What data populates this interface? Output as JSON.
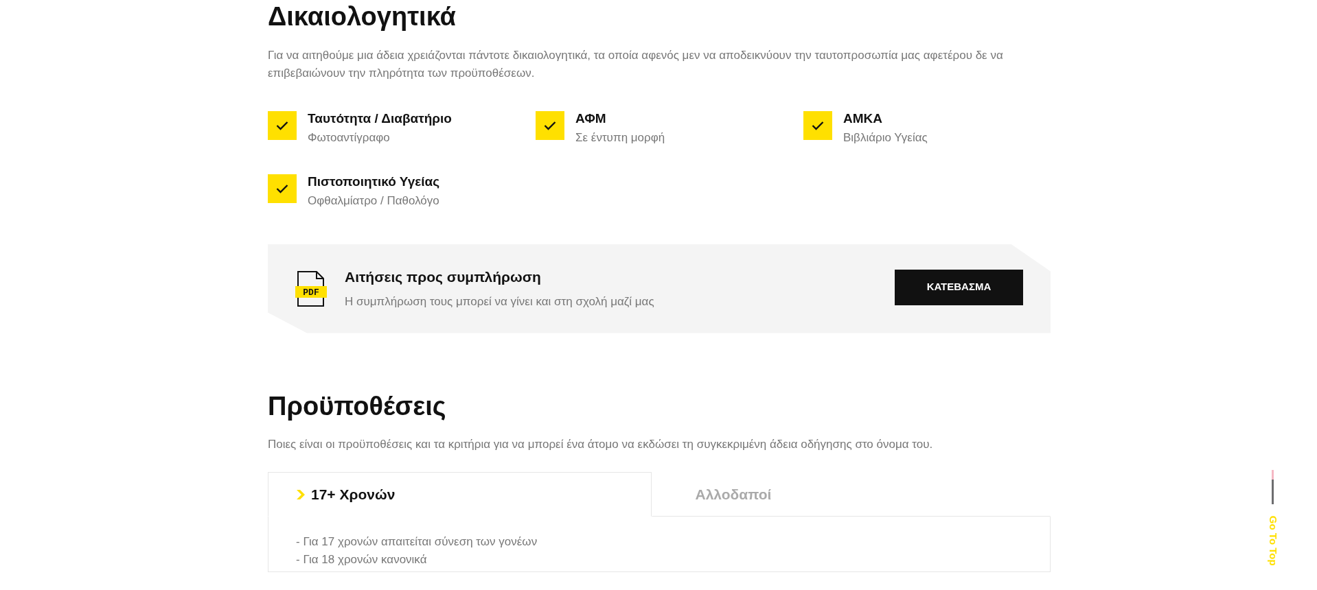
{
  "documents_section": {
    "title": "Δικαιολογητικά",
    "intro": "Για να αιτηθούμε μια άδεια χρειάζονται πάντοτε δικαιολογητικά, τα οποία αφενός μεν να αποδεικνύουν την ταυτοπροσωπία μας αφετέρου δε να επιβεβαιώνουν την πληρότητα των προϋποθέσεων.",
    "items": [
      {
        "title": "Ταυτότητα / Διαβατήριο",
        "subtitle": "Φωτοαντίγραφο"
      },
      {
        "title": "ΑΦΜ",
        "subtitle": "Σε έντυπη μορφή"
      },
      {
        "title": "ΑΜΚΑ",
        "subtitle": "Βιβλιάριο Υγείας"
      },
      {
        "title": "Πιστοποιητικό Υγείας",
        "subtitle": "Οφθαλμίατρο / Παθολόγο"
      }
    ],
    "download": {
      "file_badge": "PDF",
      "title": "Αιτήσεις προς συμπλήρωση",
      "subtitle": "Η συμπλήρωση τους μπορεί να γίνει και στη σχολή μαζί μας",
      "button": "ΚΑΤΕΒΑΣΜΑ"
    }
  },
  "requirements_section": {
    "title": "Προϋποθέσεις",
    "intro": "Ποιες είναι οι προϋποθέσεις και τα κριτήρια για να μπορεί ένα άτομο να εκδώσει τη συγκεκριμένη άδεια οδήγησης στο όνομα του.",
    "tabs": [
      {
        "label": "17+ Χρονών",
        "selected": true
      },
      {
        "label": "Αλλοδαποί",
        "selected": false
      }
    ],
    "panel_lines": [
      "- Για 17 χρονών απαιτείται σύνεση των γονέων",
      "- Για 18 χρονών κανονικά"
    ]
  },
  "go_to_top": "Go To Top"
}
